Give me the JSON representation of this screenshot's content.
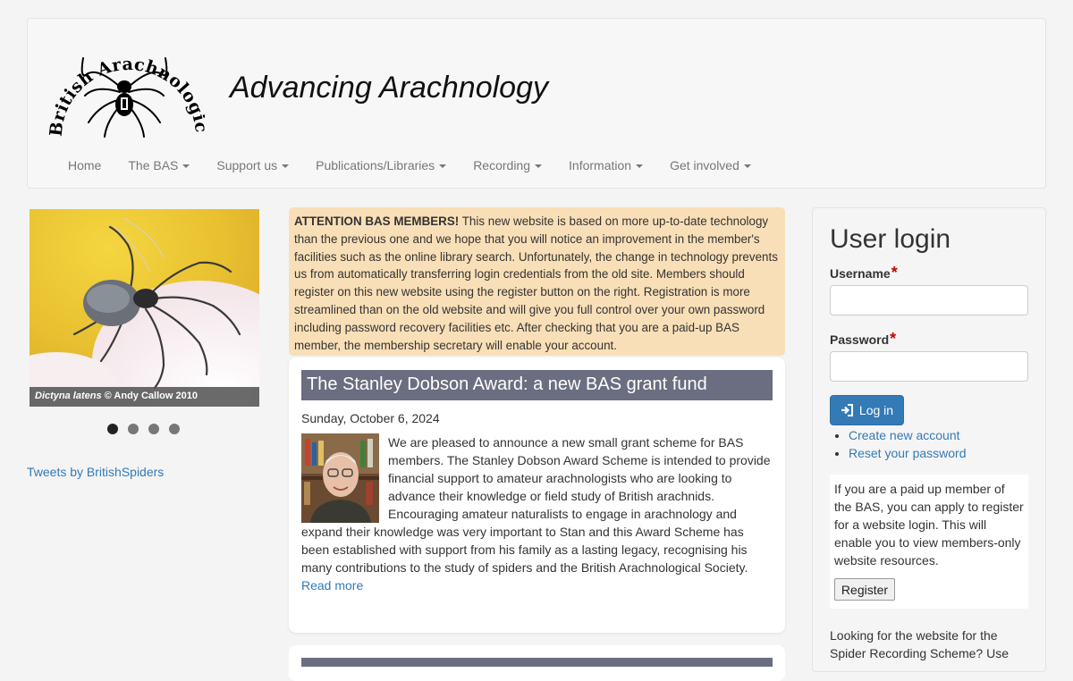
{
  "header": {
    "logo_text": "British Arachnological Society",
    "tagline": "Advancing Arachnology"
  },
  "nav": [
    {
      "label": "Home",
      "dropdown": false
    },
    {
      "label": "The BAS",
      "dropdown": true
    },
    {
      "label": "Support us",
      "dropdown": true
    },
    {
      "label": "Publications/Libraries",
      "dropdown": true
    },
    {
      "label": "Recording",
      "dropdown": true
    },
    {
      "label": "Information",
      "dropdown": true
    },
    {
      "label": "Get involved",
      "dropdown": true
    }
  ],
  "slideshow": {
    "caption_species": "Dictyna latens",
    "caption_credit": " © Andy Callow 2010",
    "dots": 4,
    "active_index": 0
  },
  "tweets_link": "Tweets by BritishSpiders",
  "notice": {
    "heading": "ATTENTION BAS MEMBERS!",
    "text": " This new website is based on more up-to-date technology than the previous one and we hope that you will notice an improvement in the member's facilities such as the online library search. Unfortunately, the change in technology prevents us from automatically transferring login credentials from the old site. Members should register on this new website using the register button on the right. Registration is more streamlined than on the old website and will give you full control over your own password including password recovery facilities etc. After checking that you are a paid-up BAS member, the membership secretary will enable your account."
  },
  "article": {
    "title": "The Stanley Dobson Award: a new BAS grant fund",
    "date": "Sunday, October 6, 2024",
    "body": "We are pleased to announce a new small grant scheme for BAS members. The Stanley Dobson Award Scheme is intended to provide financial support to amateur arachnologists who are looking to advance their knowledge or field study of British arachnids. Encouraging amateur naturalists to engage in arachnology and expand their knowledge was very important to Stan and this Award Scheme has been established with support from his family as a lasting legacy, recognising his many contributions to the study of spiders and the British Arachnological Society.",
    "read_more": "Read more"
  },
  "login": {
    "title": "User login",
    "username_label": "Username",
    "password_label": "Password",
    "required_mark": "*",
    "login_button": "Log in",
    "links": [
      "Create new account",
      "Reset your password"
    ],
    "register_text": "If you are a paid up member of the BAS, you can apply to register for a website login. This will enable you to view members-only website resources.",
    "register_button": "Register",
    "srs_text": "Looking for the website for the Spider Recording Scheme? Use"
  }
}
